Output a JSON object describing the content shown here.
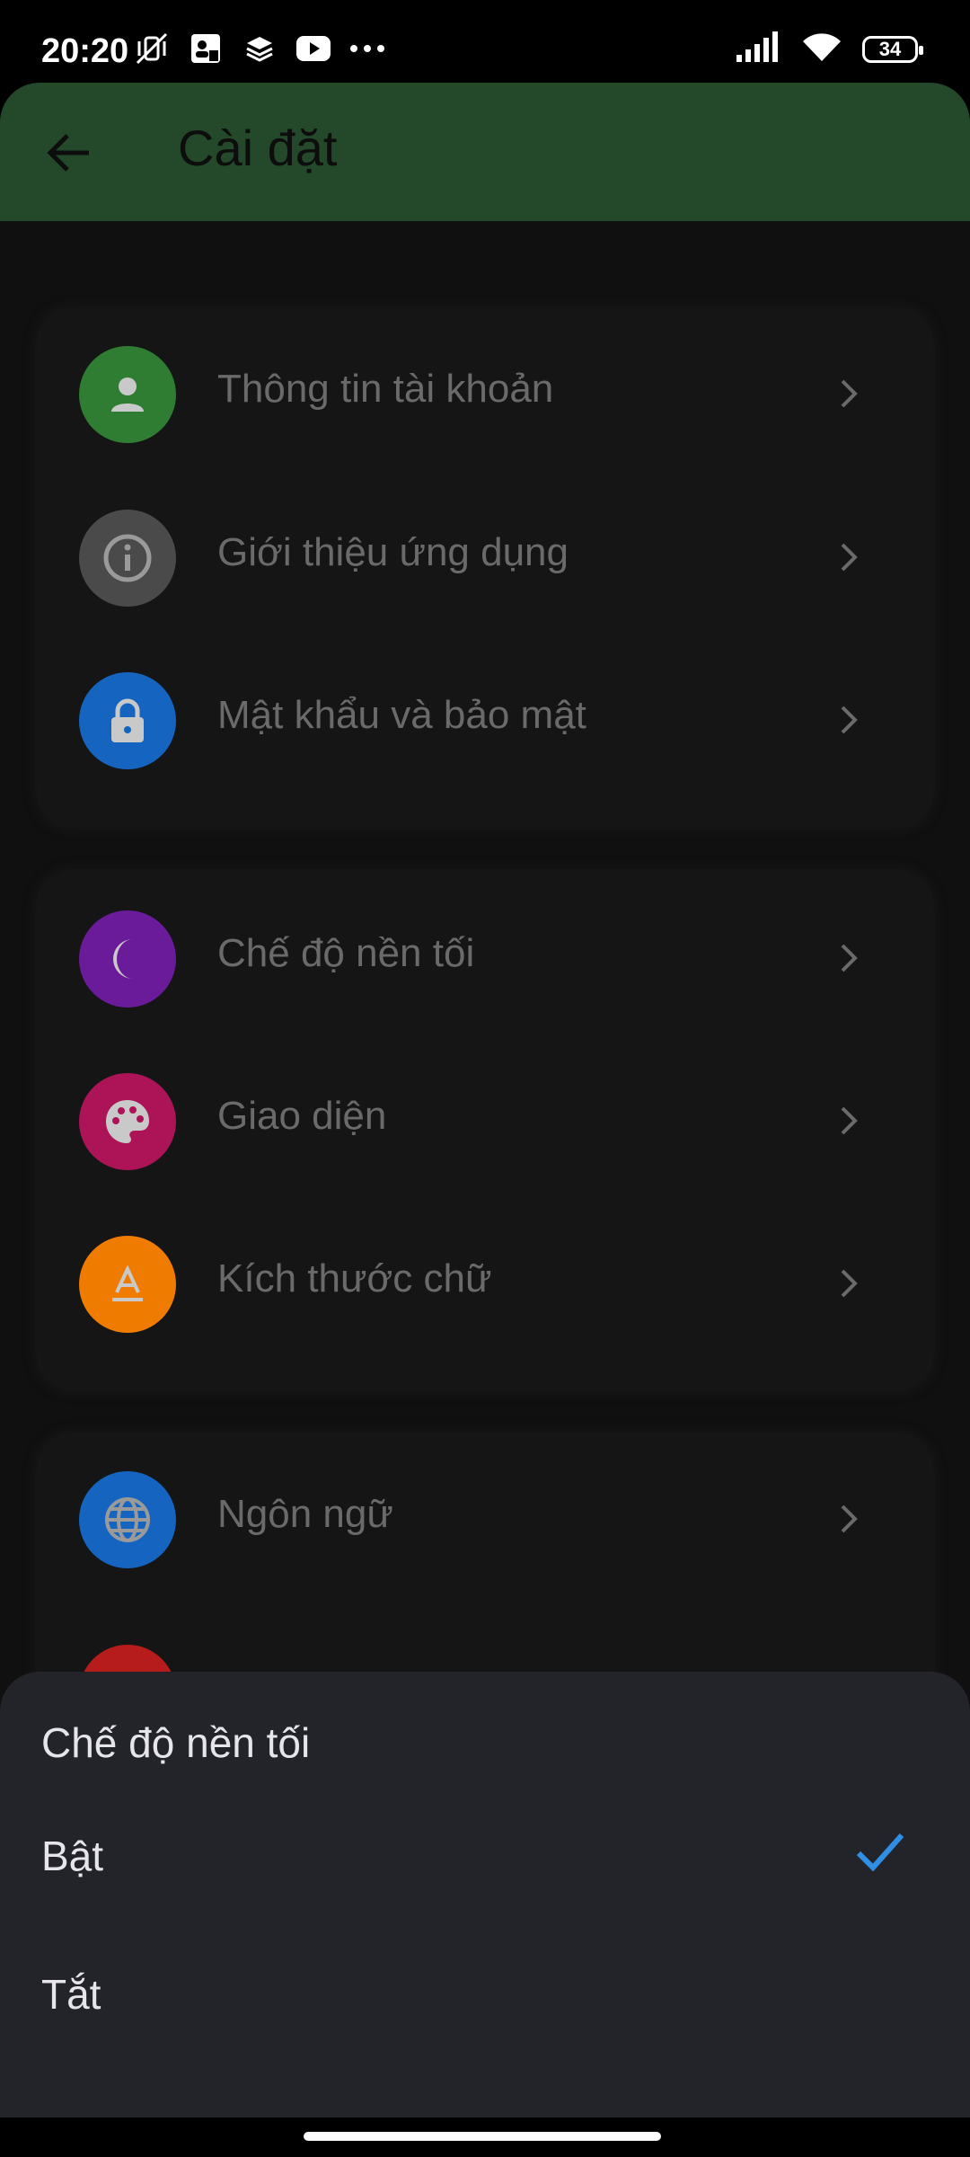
{
  "status_bar": {
    "time": "20:20",
    "battery": "34",
    "icons": [
      "vibrate-off-icon",
      "contact-app-icon",
      "stack-icon",
      "youtube-icon",
      "more-dots-icon",
      "signal-icon",
      "wifi-icon",
      "battery-icon"
    ]
  },
  "app_bar": {
    "title": "Cài đặt",
    "back_icon": "arrow-back-icon",
    "color": "#23492a"
  },
  "groups": [
    {
      "items": [
        {
          "label": "Thông tin tài khoản",
          "icon": "person-icon",
          "color": "#2e7d32"
        },
        {
          "label": "Giới thiệu ứng dụng",
          "icon": "info-icon",
          "color": "#4a4a4a"
        },
        {
          "label": "Mật khẩu và bảo mật",
          "icon": "lock-icon",
          "color": "#1565c0"
        }
      ]
    },
    {
      "items": [
        {
          "label": "Chế độ nền tối",
          "icon": "moon-icon",
          "color": "#6a1b9a"
        },
        {
          "label": "Giao diện",
          "icon": "palette-icon",
          "color": "#ad1457"
        },
        {
          "label": "Kích thước chữ",
          "icon": "text-format-icon",
          "color": "#ef7c00"
        }
      ]
    },
    {
      "items": [
        {
          "label": "Ngôn ngữ",
          "icon": "globe-icon",
          "color": "#1565c0"
        }
      ]
    }
  ],
  "bottom_sheet": {
    "title": "Chế độ nền tối",
    "options": [
      {
        "label": "Bật",
        "selected": true
      },
      {
        "label": "Tắt",
        "selected": false
      }
    ],
    "check_color": "#2f8fe6"
  }
}
